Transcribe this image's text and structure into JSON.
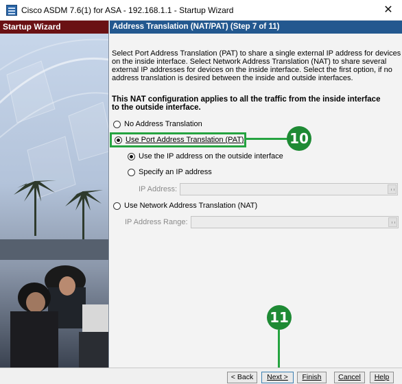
{
  "window": {
    "title": "Cisco ASDM 7.6(1) for ASA - 192.168.1.1 - Startup Wizard",
    "close_glyph": "✕"
  },
  "left_panel": {
    "header": "Startup Wizard"
  },
  "step_header": "Address Translation (NAT/PAT)  (Step 7 of 11)",
  "description_lines": [
    "Select Port Address Translation (PAT) to share a single external IP address for devices",
    "on the inside interface. Select Network Address Translation (NAT) to share several",
    "external IP addresses for devices on the inside interface. Select the first option, if no",
    "address translation is desired between the inside and outside interfaces."
  ],
  "note_lines": [
    "This NAT configuration applies to all the traffic from the inside interface",
    "to the outside interface."
  ],
  "options": {
    "no_translation": "No Address Translation",
    "pat": "Use Port Address Translation (PAT)",
    "pat_outside_ip": "Use the IP address on the outside interface",
    "pat_specify_ip": "Specify an IP address",
    "ip_address_label": "IP Address:",
    "ip_address_value": "",
    "nat": "Use Network Address Translation (NAT)",
    "ip_range_label": "IP Address Range:",
    "ip_range_value": ""
  },
  "selected": {
    "mode": "pat",
    "pat_sub": "outside_ip"
  },
  "annotations": {
    "step10": "10",
    "step11": "11",
    "highlight_color": "#25a340"
  },
  "buttons": {
    "back": "< Back",
    "next": "Next >",
    "finish": "Finish",
    "cancel": "Cancel",
    "help": "Help"
  }
}
